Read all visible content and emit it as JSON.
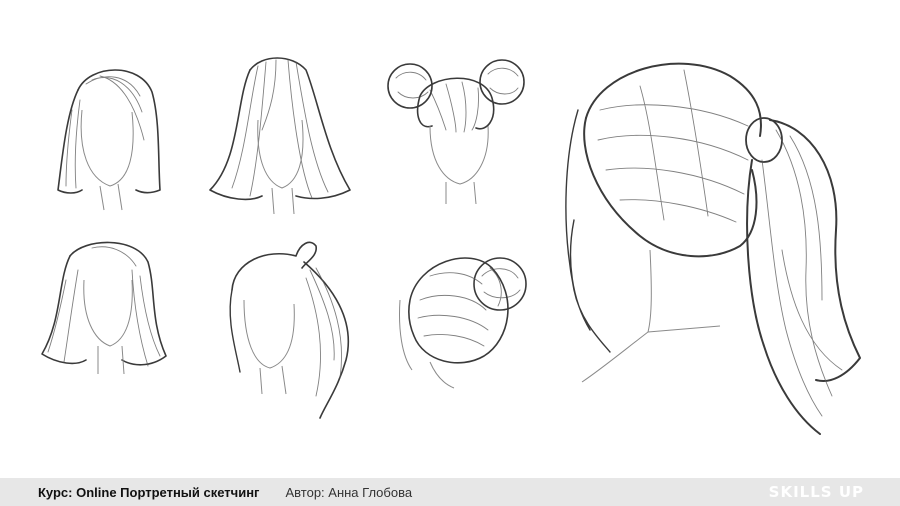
{
  "footer": {
    "course_label": "Курс: Online Портретный скетчинг",
    "author_label": "Автор: Анна Глобова",
    "logo_text": "SKILLS UP"
  },
  "colors": {
    "background": "#ffffff",
    "footer_bar": "#e7e7e7",
    "ink": "#3a3a3a",
    "logo": "#ffffff"
  }
}
